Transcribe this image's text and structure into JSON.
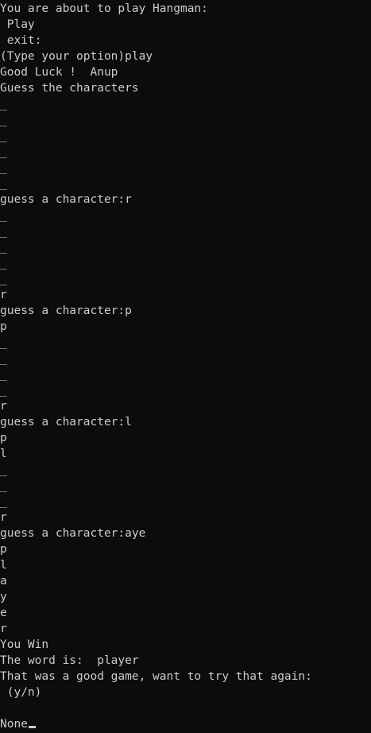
{
  "terminal": {
    "colors": {
      "background": "#0c0c0c",
      "foreground": "#cccccc"
    },
    "lines": [
      "You are about to play Hangman:",
      " Play",
      " exit:",
      "(Type your option)play",
      "Good Luck !  Anup",
      "Guess the characters",
      "_",
      "_",
      "_",
      "_",
      "_",
      "_",
      "guess a character:r",
      "_",
      "_",
      "_",
      "_",
      "_",
      "r",
      "guess a character:p",
      "p",
      "_",
      "_",
      "_",
      "_",
      "r",
      "guess a character:l",
      "p",
      "l",
      "_",
      "_",
      "_",
      "r",
      "guess a character:aye",
      "p",
      "l",
      "a",
      "y",
      "e",
      "r",
      "You Win",
      "The word is:  player",
      "That was a good game, want to try that again:",
      " (y/n)",
      "",
      "None"
    ],
    "cursor_line": 45
  }
}
